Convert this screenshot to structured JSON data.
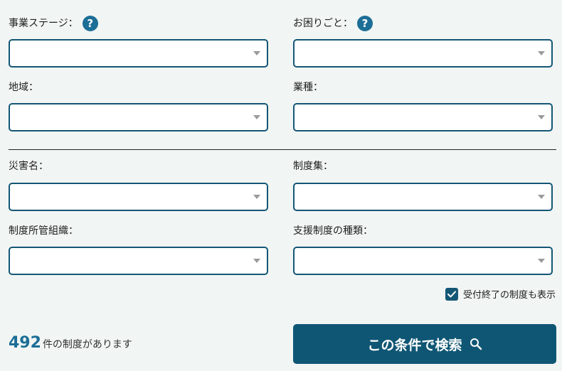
{
  "filters": {
    "business_stage": {
      "label": "事業ステージ：",
      "value": ""
    },
    "trouble": {
      "label": "お困りごと：",
      "value": ""
    },
    "region": {
      "label": "地域：",
      "value": ""
    },
    "industry": {
      "label": "業種：",
      "value": ""
    },
    "disaster": {
      "label": "災害名：",
      "value": ""
    },
    "collection": {
      "label": "制度集：",
      "value": ""
    },
    "organization": {
      "label": "制度所管組織：",
      "value": ""
    },
    "support_type": {
      "label": "支援制度の種類：",
      "value": ""
    }
  },
  "help_icon_glyph": "?",
  "include_closed": {
    "label": "受付終了の制度も表示",
    "checked": true
  },
  "result": {
    "count": "492",
    "suffix": "件の制度があります"
  },
  "search_button": {
    "label": "この条件で検索"
  },
  "colors": {
    "accent": "#1c6e96",
    "border": "#145775",
    "button": "#0f5674",
    "background": "#f1f5f4"
  }
}
